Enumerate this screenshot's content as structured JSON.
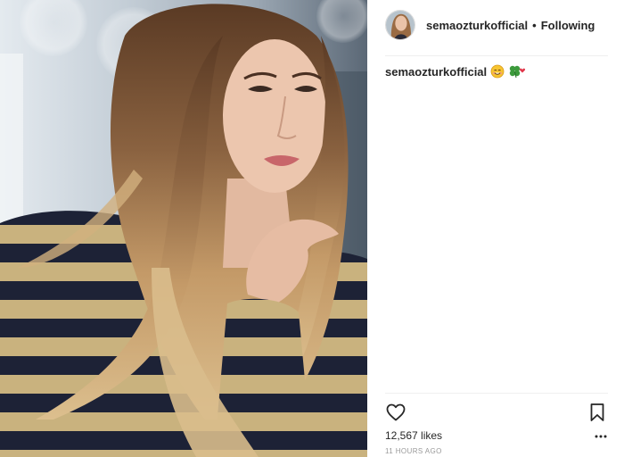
{
  "post": {
    "image_alt": "Portrait photo of a woman with long ombre hair in a striped sequin top",
    "header": {
      "username": "semaozturkofficial",
      "separator": "•",
      "follow_status": "Following"
    },
    "caption": {
      "username": "semaozturkofficial",
      "emojis": [
        "smiling-face-emoji",
        "four-leaf-clover-heart-emoji"
      ]
    },
    "actions": {
      "like_icon": "heart-outline-icon",
      "save_icon": "bookmark-outline-icon",
      "more_icon": "ellipsis-icon"
    },
    "likes_text": "12,567 likes",
    "timestamp": "11 HOURS AGO"
  },
  "colors": {
    "text": "#262626",
    "muted": "#999999",
    "divider": "#efefef",
    "background": "#ffffff"
  }
}
